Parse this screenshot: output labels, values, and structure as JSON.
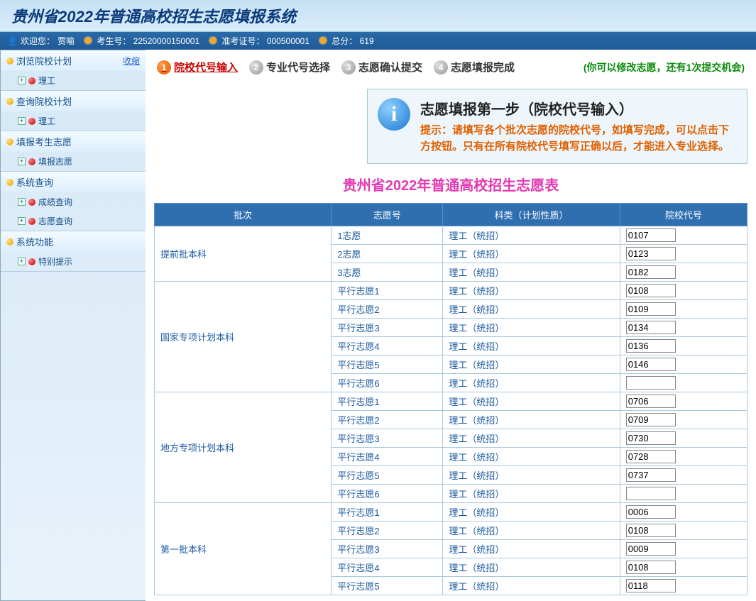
{
  "header": {
    "title": "贵州省2022年普通高校招生志愿填报系统"
  },
  "topbar": {
    "welcome_prefix": "欢迎您：",
    "username": "贾喻",
    "examinee_label": "考生号：",
    "examinee_no": "22520000150001",
    "ticket_label": "准考证号：",
    "ticket_no": "000500001",
    "score_label": "总分：",
    "score": "619"
  },
  "sidebar": {
    "shrink": "收缩",
    "groups": [
      {
        "head": "浏览院校计划",
        "items": [
          "理工"
        ]
      },
      {
        "head": "查询院校计划",
        "items": [
          "理工"
        ]
      },
      {
        "head": "填报考生志愿",
        "items": [
          "填报志愿"
        ]
      },
      {
        "head": "系统查询",
        "items": [
          "成绩查询",
          "志愿查询"
        ]
      },
      {
        "head": "系统功能",
        "items": [
          "特别提示"
        ]
      }
    ]
  },
  "steps": {
    "items": [
      "院校代号输入",
      "专业代号选择",
      "志愿确认提交",
      "志愿填报完成"
    ],
    "remain": "(你可以修改志愿，还有1次提交机会)"
  },
  "infobox": {
    "title": "志愿填报第一步（院校代号输入）",
    "text": "提示：请填写各个批次志愿的院校代号，如填写完成，可以点击下方按钮。只有在所有院校代号填写正确以后，才能进入专业选择。"
  },
  "table": {
    "title": "贵州省2022年普通高校招生志愿表",
    "headers": [
      "批次",
      "志愿号",
      "科类（计划性质）",
      "院校代号"
    ],
    "batches": [
      {
        "name": "提前批本科",
        "rows": [
          {
            "wish": "1志愿",
            "cat": "理工（统招）",
            "code": "0107"
          },
          {
            "wish": "2志愿",
            "cat": "理工（统招）",
            "code": "0123"
          },
          {
            "wish": "3志愿",
            "cat": "理工（统招）",
            "code": "0182"
          }
        ]
      },
      {
        "name": "国家专项计划本科",
        "rows": [
          {
            "wish": "平行志愿1",
            "cat": "理工（统招）",
            "code": "0108"
          },
          {
            "wish": "平行志愿2",
            "cat": "理工（统招）",
            "code": "0109"
          },
          {
            "wish": "平行志愿3",
            "cat": "理工（统招）",
            "code": "0134"
          },
          {
            "wish": "平行志愿4",
            "cat": "理工（统招）",
            "code": "0136"
          },
          {
            "wish": "平行志愿5",
            "cat": "理工（统招）",
            "code": "0146"
          },
          {
            "wish": "平行志愿6",
            "cat": "理工（统招）",
            "code": ""
          }
        ]
      },
      {
        "name": "地方专项计划本科",
        "rows": [
          {
            "wish": "平行志愿1",
            "cat": "理工（统招）",
            "code": "0706"
          },
          {
            "wish": "平行志愿2",
            "cat": "理工（统招）",
            "code": "0709"
          },
          {
            "wish": "平行志愿3",
            "cat": "理工（统招）",
            "code": "0730"
          },
          {
            "wish": "平行志愿4",
            "cat": "理工（统招）",
            "code": "0728"
          },
          {
            "wish": "平行志愿5",
            "cat": "理工（统招）",
            "code": "0737"
          },
          {
            "wish": "平行志愿6",
            "cat": "理工（统招）",
            "code": ""
          }
        ]
      },
      {
        "name": "第一批本科",
        "rows": [
          {
            "wish": "平行志愿1",
            "cat": "理工（统招）",
            "code": "0006"
          },
          {
            "wish": "平行志愿2",
            "cat": "理工（统招）",
            "code": "0108"
          },
          {
            "wish": "平行志愿3",
            "cat": "理工（统招）",
            "code": "0009"
          },
          {
            "wish": "平行志愿4",
            "cat": "理工（统招）",
            "code": "0108"
          },
          {
            "wish": "平行志愿5",
            "cat": "理工（统招）",
            "code": "0118"
          }
        ]
      }
    ]
  }
}
